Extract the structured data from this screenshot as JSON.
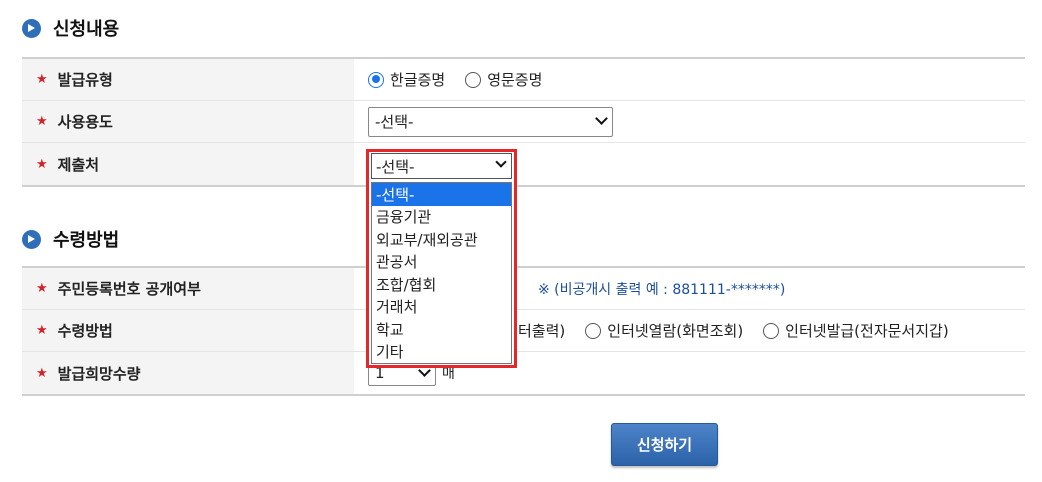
{
  "section1": {
    "title": "신청내용",
    "rows": {
      "type_label": "발급유형",
      "purpose_label": "사용용도",
      "destination_label": "제출처"
    },
    "type_options": [
      "한글증명",
      "영문증명"
    ],
    "type_selected": "한글증명",
    "purpose_value": "-선택-",
    "destination_value": "-선택-"
  },
  "section2": {
    "title": "수령방법",
    "rows": {
      "resident_label": "주민등록번호 공개여부",
      "receive_label": "수령방법",
      "quantity_label": "발급희망수량"
    },
    "resident_notice": "※ (비공개시 출력 예 : 881111-*******)",
    "receive_partial": "터출력)",
    "receive_options": [
      "인터넷열람(화면조회)",
      "인터넷발급(전자문서지갑)"
    ],
    "quantity_value": "1",
    "quantity_unit": "매"
  },
  "dropdown": {
    "value": "-선택-",
    "options": [
      "-선택-",
      "금융기관",
      "외교부/재외공관",
      "관공서",
      "조합/협회",
      "거래처",
      "학교",
      "기타"
    ],
    "selected_index": 0
  },
  "submit_label": "신청하기",
  "colors": {
    "accent": "#2f6fb7",
    "required": "#d2232a",
    "highlight": "#e5262b",
    "option_selected": "#1a73e8",
    "notice": "#1b4f9c"
  }
}
